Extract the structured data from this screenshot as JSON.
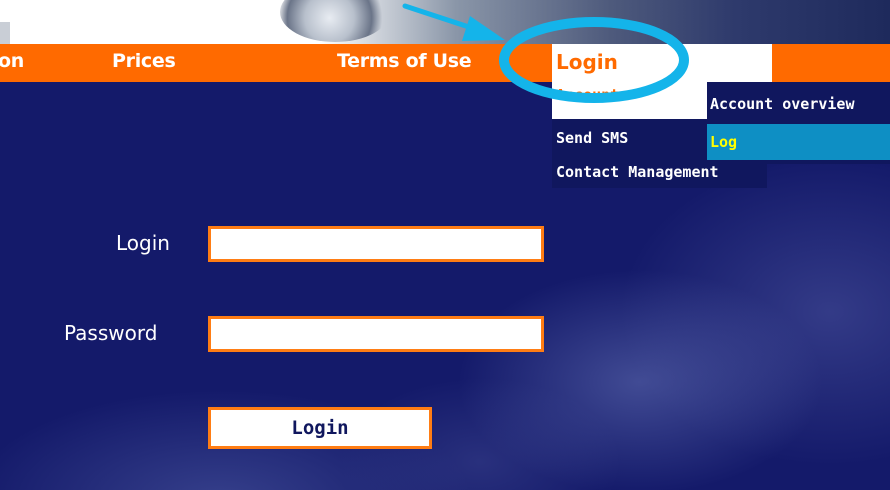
{
  "nav": {
    "items": [
      "on",
      "Prices",
      "Terms of Use"
    ],
    "login_label": "Login"
  },
  "dropdown": {
    "first_label": "Account",
    "items": [
      "Send SMS",
      "Contact Management"
    ]
  },
  "submenu": {
    "items": [
      "Account overview",
      "Log"
    ],
    "active_index": 1
  },
  "form": {
    "login_label": "Login",
    "login_value": "",
    "password_label": "Password",
    "password_value": "",
    "submit_label": "Login"
  },
  "colors": {
    "accent_orange": "#ff6a00",
    "background_navy": "#141a6a",
    "menu_navy": "#10175e",
    "highlight_blue": "#0e8fc4",
    "highlight_text": "#ffff00",
    "annotation_cyan": "#14b4ea"
  },
  "icons": {
    "annotation_arrow": "arrow-icon",
    "annotation_circle": "highlight-ellipse-icon"
  }
}
